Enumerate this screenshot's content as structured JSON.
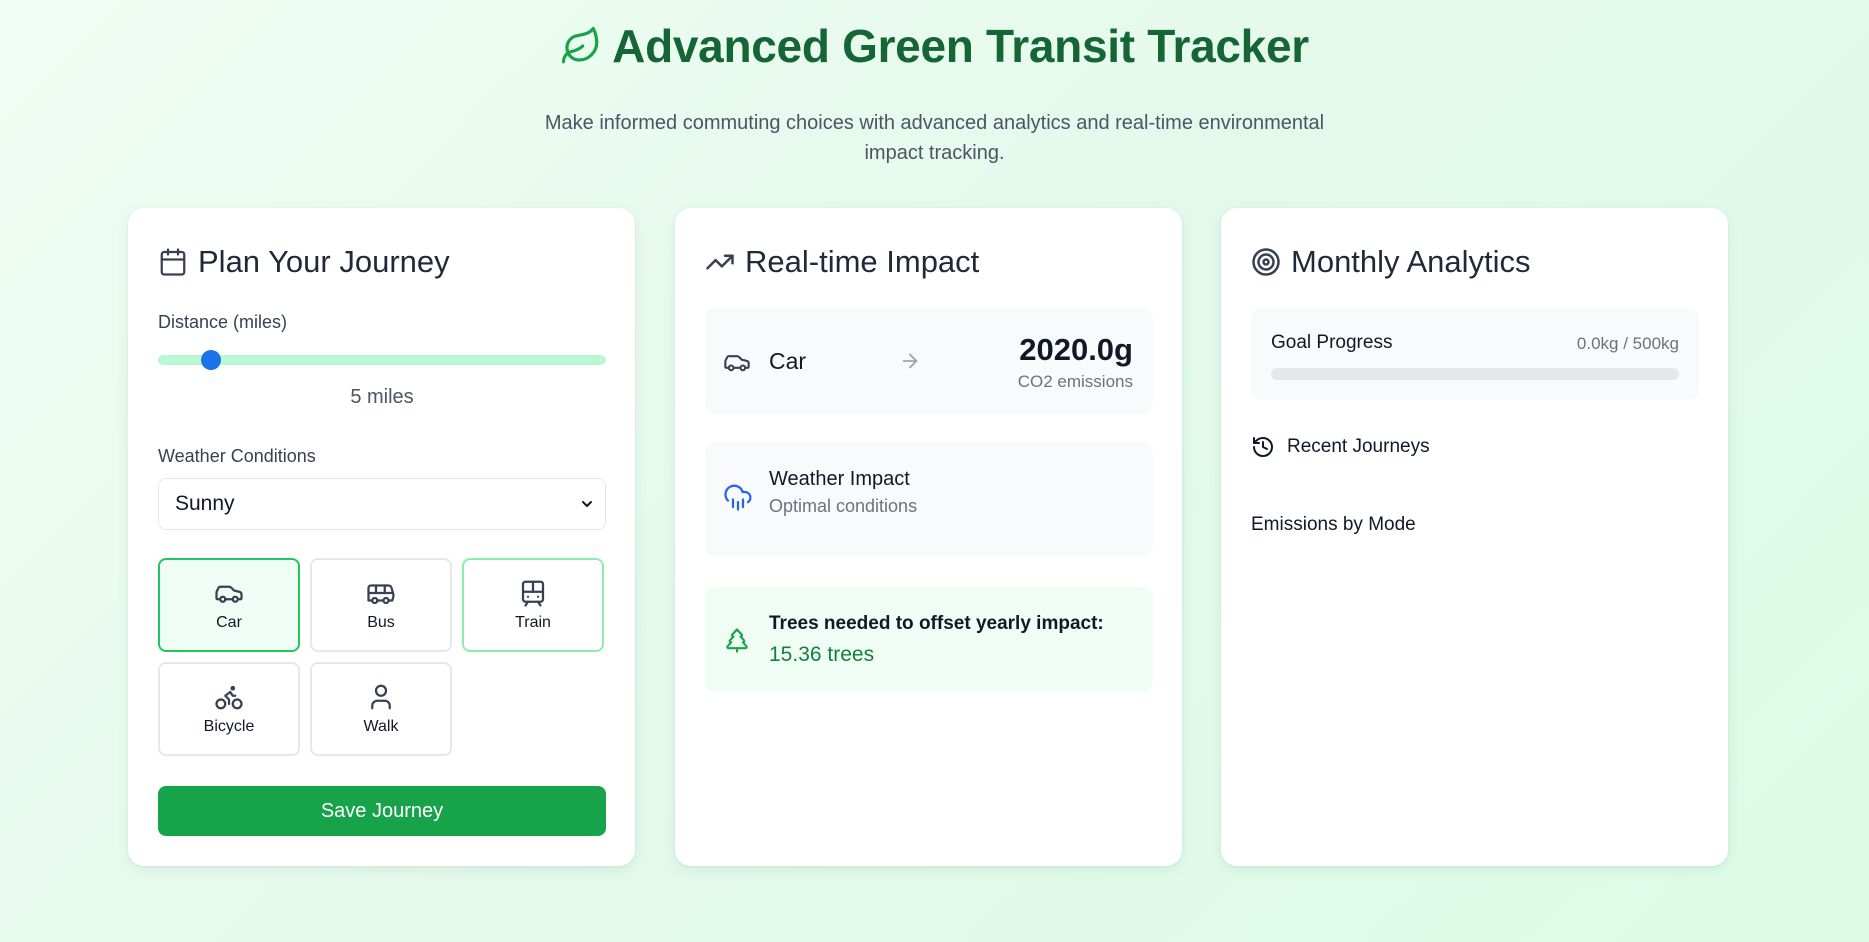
{
  "header": {
    "title": "Advanced Green Transit Tracker",
    "subtitle": "Make informed commuting choices with advanced analytics and real-time environmental impact tracking."
  },
  "colors": {
    "brand_green": "#166534",
    "accent_green": "#16a34a",
    "slider_thumb": "#1a73e8"
  },
  "planner": {
    "title": "Plan Your Journey",
    "icon": "calendar-icon",
    "distance_label": "Distance (miles)",
    "distance_value": 5,
    "distance_min": 0,
    "distance_max": 50,
    "distance_display": "5 miles",
    "weather_label": "Weather Conditions",
    "weather_selected": "Sunny",
    "modes": [
      {
        "label": "Car",
        "icon": "car-icon",
        "state": "selected"
      },
      {
        "label": "Bus",
        "icon": "bus-icon",
        "state": "default"
      },
      {
        "label": "Train",
        "icon": "train-icon",
        "state": "compare"
      },
      {
        "label": "Bicycle",
        "icon": "bicycle-icon",
        "state": "default"
      },
      {
        "label": "Walk",
        "icon": "walk-icon",
        "state": "default"
      }
    ],
    "save_label": "Save Journey"
  },
  "impact": {
    "title": "Real-time Impact",
    "icon": "trending-up-icon",
    "mode_name": "Car",
    "emission_value": "2020.0g",
    "emission_unit": "CO2 emissions",
    "weather_title": "Weather Impact",
    "weather_sub": "Optimal conditions",
    "trees_title": "Trees needed to offset yearly impact:",
    "trees_value": "15.36 trees"
  },
  "analytics": {
    "title": "Monthly Analytics",
    "icon": "target-icon",
    "goal_title": "Goal Progress",
    "goal_value": "0.0kg / 500kg",
    "goal_progress": 0,
    "recent_title": "Recent Journeys",
    "emissions_title": "Emissions by Mode"
  }
}
